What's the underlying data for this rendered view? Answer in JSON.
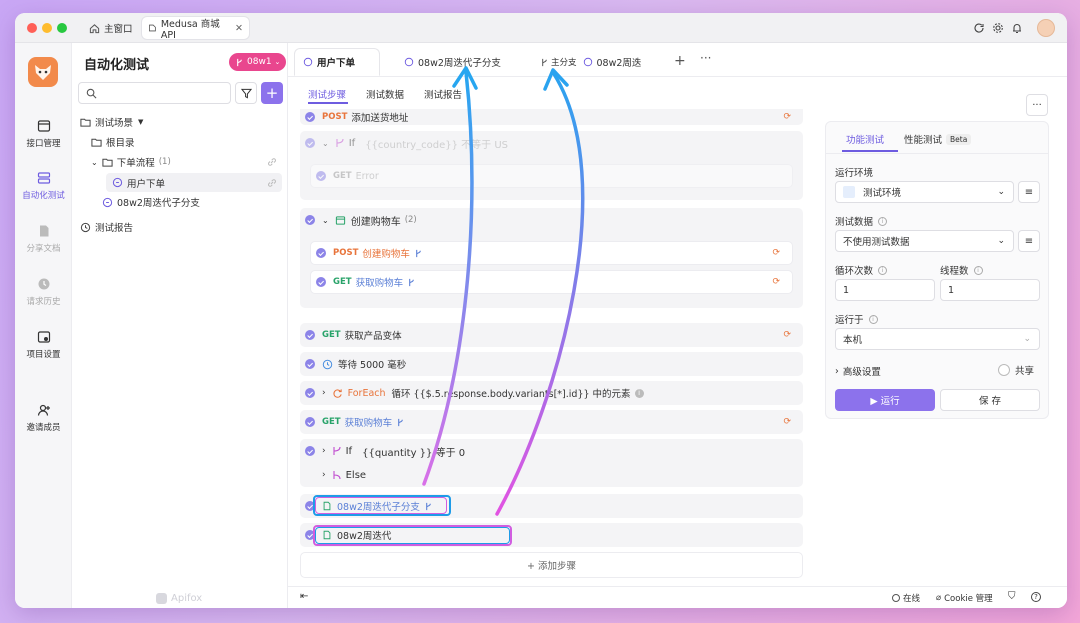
{
  "titlebar": {
    "home_tab": "主窗口",
    "project_tab": "Medusa 商城 API"
  },
  "rail": [
    {
      "label": "接口管理"
    },
    {
      "label": "自动化测试"
    },
    {
      "label": "分享文档"
    },
    {
      "label": "请求历史"
    },
    {
      "label": "项目设置"
    },
    {
      "label": "邀请成员"
    }
  ],
  "sidebar": {
    "title": "自动化测试",
    "branch": "08w1",
    "tree": {
      "scenes": "测试场景",
      "root": "根目录",
      "flow": "下单流程",
      "flow_count": "(1)",
      "order": "用户下单",
      "iter_branch": "08w2周迭代子分支",
      "report": "测试报告"
    },
    "watermark": "Apifox"
  },
  "tabs": {
    "t1": "用户下单",
    "t2": "08w2周迭代子分支",
    "t3_branch": "主分支",
    "t3": "08w2周迭"
  },
  "subtabs": {
    "steps": "测试步骤",
    "data": "测试数据",
    "report": "测试报告"
  },
  "steps": {
    "s0_method": "POST",
    "s0_name": "添加送货地址",
    "if1_kw": "If",
    "if1_expr": "{{country_code}}  不等于  US",
    "if1_child_method": "GET",
    "if1_child_name": "Error",
    "cart_group": "创建购物车",
    "cart_count": "(2)",
    "cart_post": "POST",
    "cart_post_name": "创建购物车",
    "cart_get": "GET",
    "cart_get_name": "获取购物车",
    "variant_method": "GET",
    "variant_name": "获取产品变体",
    "wait": "等待 5000 毫秒",
    "foreach_kw": "ForEach",
    "foreach_expr": "循环 {{$.5.response.body.variants[*].id}} 中的元素",
    "getcart_method": "GET",
    "getcart_name": "获取购物车",
    "if2_kw": "If",
    "if2_expr": "{{quantity }}  等于  0",
    "else_kw": "Else",
    "ref1": "08w2周迭代子分支",
    "ref2": "08w2周迭代",
    "add": "+ 添加步骤"
  },
  "panel": {
    "tab_func": "功能测试",
    "tab_perf": "性能测试",
    "beta": "Beta",
    "env_label": "运行环境",
    "env_value": "测试环境",
    "data_label": "测试数据",
    "data_value": "不使用测试数据",
    "loop_label": "循环次数",
    "thread_label": "线程数",
    "loop_value": "1",
    "thread_value": "1",
    "runon_label": "运行于",
    "runon_value": "本机",
    "advanced": "高级设置",
    "share": "共享",
    "run": "▶ 运行",
    "save": "保 存"
  },
  "bottom": {
    "online": "在线",
    "cookie": "Cookie 管理"
  },
  "colors": {
    "accent": "#8c84e8",
    "post": "#e8743b",
    "get": "#29a36a",
    "arrow_blue": "#2aa3ef",
    "arrow_pink": "#e35be6"
  }
}
